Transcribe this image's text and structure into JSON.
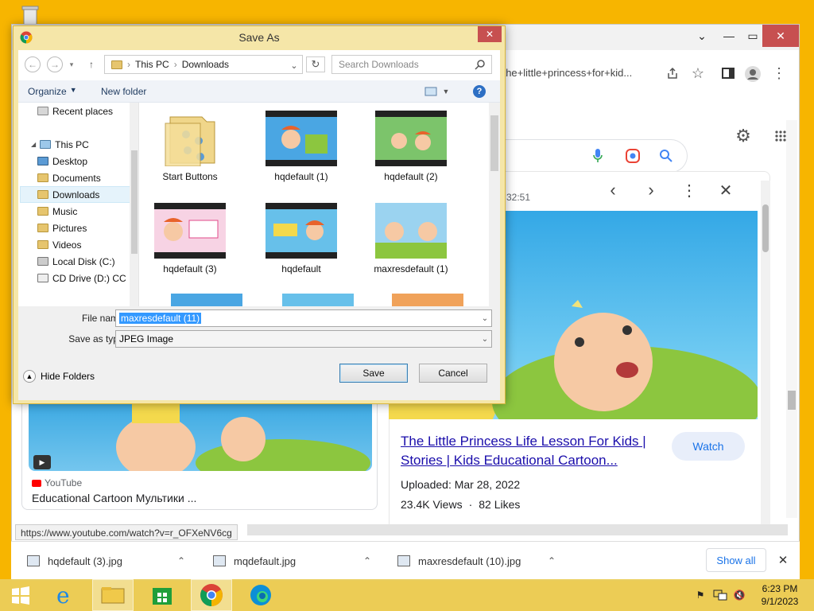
{
  "dialog": {
    "title": "Save As",
    "address": [
      "This PC",
      "Downloads"
    ],
    "search_placeholder": "Search Downloads",
    "organize_label": "Organize",
    "new_folder_label": "New folder",
    "tree": [
      {
        "label": "Recent places",
        "selected": false
      },
      {
        "label": "This PC",
        "selected": false
      },
      {
        "label": "Desktop",
        "selected": false
      },
      {
        "label": "Documents",
        "selected": false
      },
      {
        "label": "Downloads",
        "selected": true
      },
      {
        "label": "Music",
        "selected": false
      },
      {
        "label": "Pictures",
        "selected": false
      },
      {
        "label": "Videos",
        "selected": false
      },
      {
        "label": "Local Disk (C:)",
        "selected": false
      },
      {
        "label": "CD Drive (D:) CC",
        "selected": false
      }
    ],
    "files": [
      {
        "name": "Start Buttons",
        "type": "folder"
      },
      {
        "name": "hqdefault (1)",
        "type": "image"
      },
      {
        "name": "hqdefault (2)",
        "type": "image"
      },
      {
        "name": "hqdefault (3)",
        "type": "image"
      },
      {
        "name": "hqdefault",
        "type": "image"
      },
      {
        "name": "maxresdefault (1)",
        "type": "image"
      }
    ],
    "file_name_label": "File name:",
    "file_name_value": "maxresdefault (11)",
    "save_type_label": "Save as type:",
    "save_type_value": "JPEG Image",
    "hide_folders_label": "Hide Folders",
    "save_label": "Save",
    "cancel_label": "Cancel"
  },
  "browser": {
    "omnibox_text": "=the+little+princess+for+kid...",
    "timestamp": "32:51",
    "result_title": "The Little Princess Life Lesson For Kids | Stories | Kids Educational Cartoon...",
    "watch_label": "Watch",
    "uploaded": "Uploaded: Mar 28, 2022",
    "views": "23.4K Views",
    "likes": "82 Likes",
    "left_source": "YouTube",
    "left_title": "Educational Cartoon Мультики ...",
    "status_url": "https://www.youtube.com/watch?v=r_OFXeNV6cg"
  },
  "downloads": {
    "items": [
      "hqdefault (3).jpg",
      "mqdefault.jpg",
      "maxresdefault (10).jpg"
    ],
    "show_all": "Show all"
  },
  "taskbar": {
    "time": "6:23 PM",
    "date": "9/1/2023"
  },
  "colors": {
    "desktop": "#f7b500",
    "dialog_frame": "#f5e6a8",
    "link": "#1a0dab",
    "accent": "#1a73e8"
  }
}
